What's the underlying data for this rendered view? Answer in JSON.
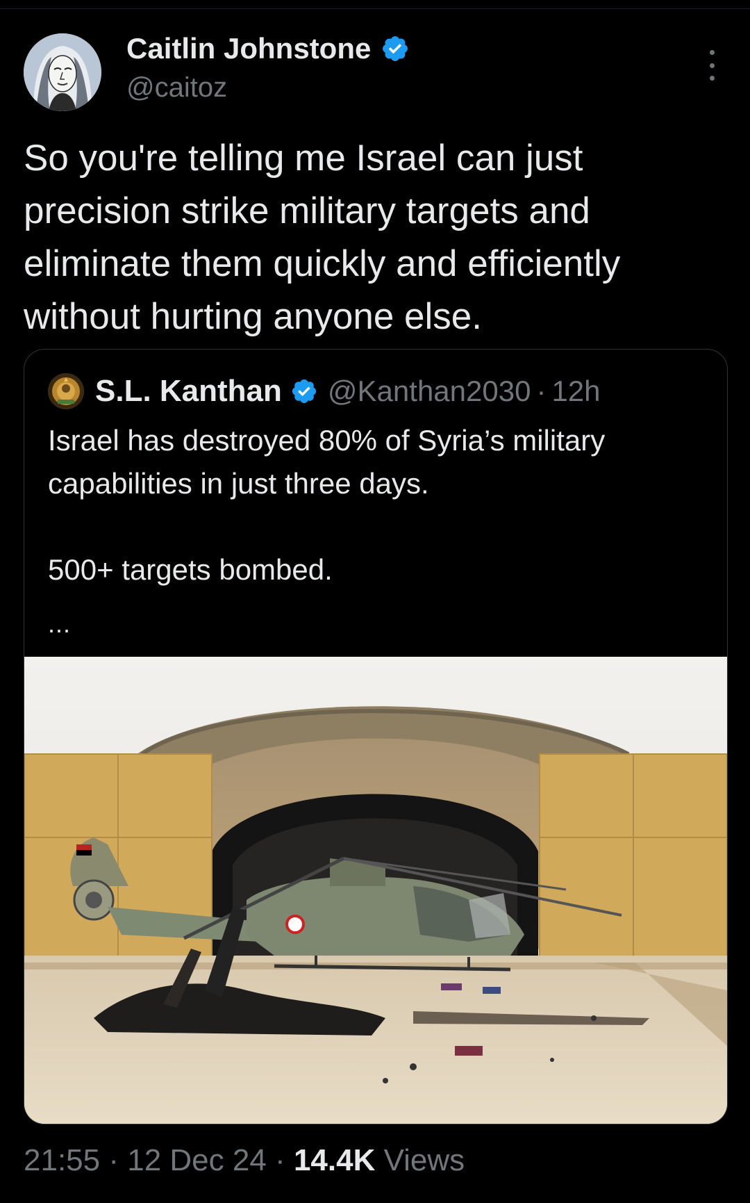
{
  "tweet": {
    "author_name": "Caitlin Johnstone",
    "author_handle": "@caitoz",
    "text": "So you're telling me Israel can just precision strike military targets and eliminate them quickly and efficiently without hurting anyone else.",
    "time": "21:55",
    "separator": "·",
    "date": "12 Dec 24",
    "views_count": "14.4K",
    "views_label": "Views"
  },
  "quoted": {
    "author_name": "S.L. Kanthan",
    "author_handle": "@Kanthan2030",
    "separator": "·",
    "age": "12h",
    "line1": "Israel has destroyed 80% of Syria’s military capabilities in just three days.",
    "line2": "500+ targets bombed.",
    "ellipsis": "..."
  },
  "colors": {
    "background": "#000000",
    "primary_text": "#e7e9ea",
    "secondary_text": "#71767b",
    "verified_badge": "#1d9bf0",
    "border": "#2f3336"
  },
  "icons": {
    "verified": "verified-badge-icon",
    "more": "more-options-icon"
  }
}
